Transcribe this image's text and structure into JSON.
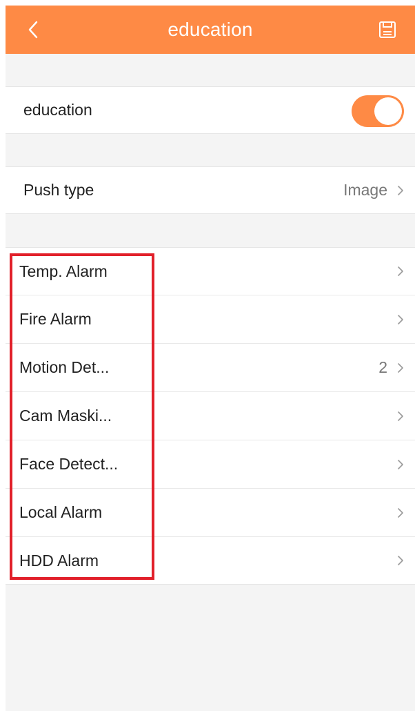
{
  "header": {
    "title": "education",
    "back_icon": "chevron-left-icon",
    "save_icon": "save-icon",
    "color": "#fe8a45"
  },
  "education_toggle": {
    "label": "education",
    "enabled": true
  },
  "push_type": {
    "label": "Push type",
    "value": "Image"
  },
  "alarm_items": [
    {
      "label": "Temp. Alarm",
      "value": ""
    },
    {
      "label": "Fire Alarm",
      "value": ""
    },
    {
      "label": "Motion Det...",
      "value": "2"
    },
    {
      "label": "Cam Maski...",
      "value": ""
    },
    {
      "label": "Face Detect...",
      "value": ""
    },
    {
      "label": "Local Alarm",
      "value": ""
    },
    {
      "label": "HDD Alarm",
      "value": ""
    }
  ],
  "colors": {
    "accent": "#fe8a45",
    "highlight": "#e1202a",
    "background": "#f4f4f4"
  }
}
